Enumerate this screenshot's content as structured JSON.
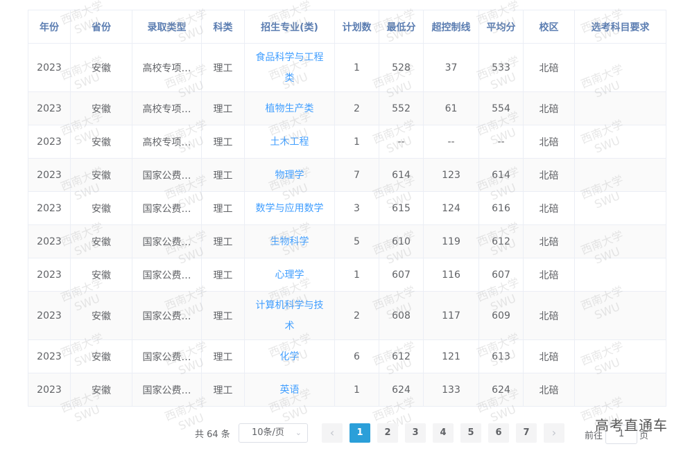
{
  "table": {
    "headers": [
      "年份",
      "省份",
      "录取类型",
      "科类",
      "招生专业(类)",
      "计划数",
      "最低分",
      "超控制线",
      "平均分",
      "校区",
      "选考科目要求"
    ],
    "rows": [
      {
        "year": "2023",
        "province": "安徽",
        "type": "高校专项…",
        "category": "理工",
        "major": "食品科学与工程类",
        "plan": "1",
        "min_score": "528",
        "over_line": "37",
        "avg_score": "533",
        "campus": "北碚",
        "subject_req": ""
      },
      {
        "year": "2023",
        "province": "安徽",
        "type": "高校专项…",
        "category": "理工",
        "major": "植物生产类",
        "plan": "2",
        "min_score": "552",
        "over_line": "61",
        "avg_score": "554",
        "campus": "北碚",
        "subject_req": ""
      },
      {
        "year": "2023",
        "province": "安徽",
        "type": "高校专项…",
        "category": "理工",
        "major": "土木工程",
        "plan": "1",
        "min_score": "--",
        "over_line": "--",
        "avg_score": "--",
        "campus": "北碚",
        "subject_req": ""
      },
      {
        "year": "2023",
        "province": "安徽",
        "type": "国家公费…",
        "category": "理工",
        "major": "物理学",
        "plan": "7",
        "min_score": "614",
        "over_line": "123",
        "avg_score": "614",
        "campus": "北碚",
        "subject_req": ""
      },
      {
        "year": "2023",
        "province": "安徽",
        "type": "国家公费…",
        "category": "理工",
        "major": "数学与应用数学",
        "plan": "3",
        "min_score": "615",
        "over_line": "124",
        "avg_score": "616",
        "campus": "北碚",
        "subject_req": ""
      },
      {
        "year": "2023",
        "province": "安徽",
        "type": "国家公费…",
        "category": "理工",
        "major": "生物科学",
        "plan": "5",
        "min_score": "610",
        "over_line": "119",
        "avg_score": "612",
        "campus": "北碚",
        "subject_req": ""
      },
      {
        "year": "2023",
        "province": "安徽",
        "type": "国家公费…",
        "category": "理工",
        "major": "心理学",
        "plan": "1",
        "min_score": "607",
        "over_line": "116",
        "avg_score": "607",
        "campus": "北碚",
        "subject_req": ""
      },
      {
        "year": "2023",
        "province": "安徽",
        "type": "国家公费…",
        "category": "理工",
        "major": "计算机科学与技术",
        "plan": "2",
        "min_score": "608",
        "over_line": "117",
        "avg_score": "609",
        "campus": "北碚",
        "subject_req": ""
      },
      {
        "year": "2023",
        "province": "安徽",
        "type": "国家公费…",
        "category": "理工",
        "major": "化学",
        "plan": "6",
        "min_score": "612",
        "over_line": "121",
        "avg_score": "613",
        "campus": "北碚",
        "subject_req": ""
      },
      {
        "year": "2023",
        "province": "安徽",
        "type": "国家公费…",
        "category": "理工",
        "major": "英语",
        "plan": "1",
        "min_score": "624",
        "over_line": "133",
        "avg_score": "624",
        "campus": "北碚",
        "subject_req": ""
      }
    ]
  },
  "pagination": {
    "total_label": "共 64 条",
    "page_size_label": "10条/页",
    "prev_icon": "‹",
    "next_icon": "›",
    "pages": [
      "1",
      "2",
      "3",
      "4",
      "5",
      "6",
      "7"
    ],
    "current_page": "1",
    "goto_label": "前往",
    "goto_value": "1",
    "page_unit": "页"
  },
  "watermark": {
    "line1": "西南大学",
    "line2": "SWU"
  },
  "corner_logo": "高考直通车",
  "colors": {
    "header_text": "#5b7db1",
    "link": "#409eff",
    "active_page": "#2b9fd9",
    "stripe": "#fafafa",
    "border": "#ebeef5"
  }
}
